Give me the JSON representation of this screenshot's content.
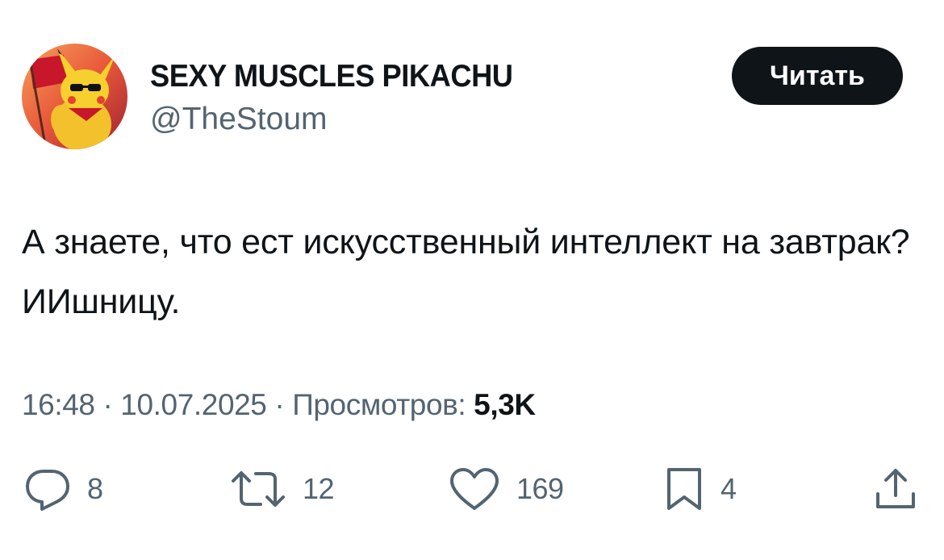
{
  "author": {
    "display_name": "SEXY MUSCLES PIKACHU",
    "handle": "@TheStoum",
    "avatar_icon": "pikachu-avatar-icon"
  },
  "follow_button": {
    "label": "Читать"
  },
  "tweet": {
    "text": "А знаете, что ест искусственный интеллект на завтрак? ИИшницу."
  },
  "meta": {
    "time": "16:48",
    "separator": "·",
    "date": "10.07.2025",
    "views_label": "Просмотров:",
    "views_count": "5,3K"
  },
  "actions": {
    "replies": "8",
    "reposts": "12",
    "likes": "169",
    "bookmarks": "4"
  },
  "colors": {
    "text_primary": "#0f1419",
    "text_secondary": "#536471",
    "button_bg": "#0f1419",
    "button_text": "#ffffff",
    "background": "#ffffff"
  }
}
